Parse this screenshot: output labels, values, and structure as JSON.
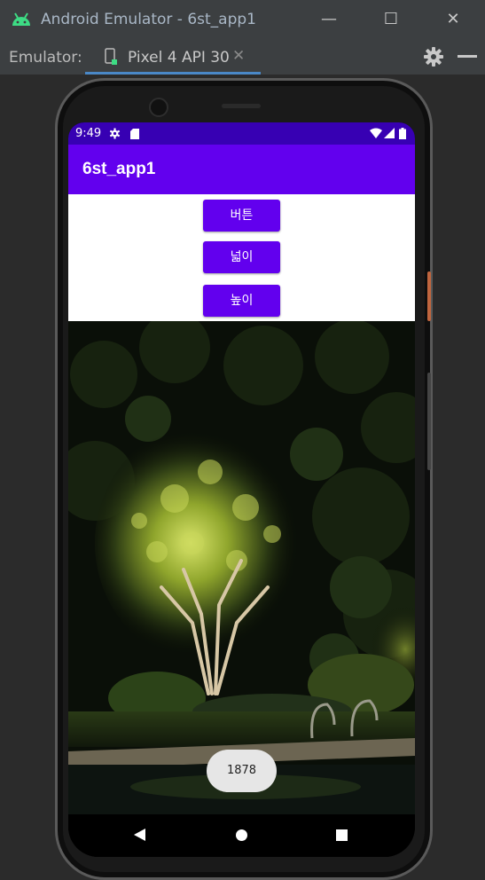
{
  "window": {
    "title": "Android Emulator - 6st_app1",
    "minimize_glyph": "—",
    "maximize_glyph": "☐",
    "close_glyph": "✕"
  },
  "toolbar": {
    "emulator_label": "Emulator:",
    "tab_label": "Pixel 4 API 30",
    "tab_close_glyph": "✕"
  },
  "status_bar": {
    "time": "9:49"
  },
  "app": {
    "title": "6st_app1",
    "buttons": [
      "버튼",
      "넓이",
      "높이"
    ],
    "toast": "1878"
  },
  "colors": {
    "primary": "#6200ee",
    "primary_dark": "#3700b3",
    "accent_tab": "#4a88c7"
  }
}
